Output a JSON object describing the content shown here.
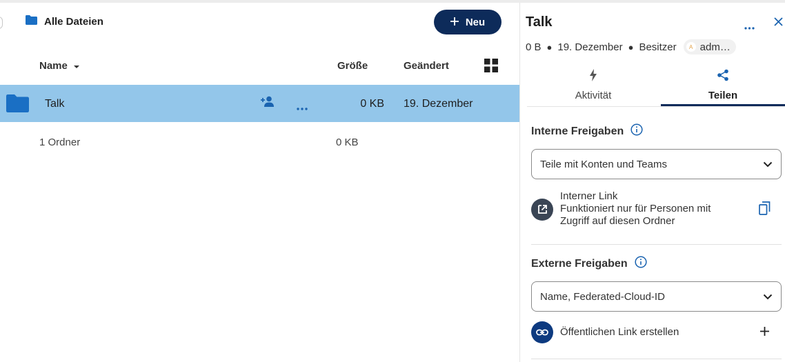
{
  "breadcrumb": {
    "label": "Alle Dateien"
  },
  "toolbar": {
    "new_label": "Neu"
  },
  "columns": {
    "name": "Name",
    "size": "Größe",
    "modified": "Geändert"
  },
  "rows": [
    {
      "name": "Talk",
      "size": "0 KB",
      "modified": "19. Dezember",
      "selected": true
    }
  ],
  "summary": {
    "count": "1 Ordner",
    "total_size": "0 KB"
  },
  "sidebar": {
    "title": "Talk",
    "size": "0 B",
    "date": "19. Dezember",
    "owner_label": "Besitzer",
    "owner_initial": "A",
    "owner_name": "adm…",
    "tabs": [
      {
        "label": "Aktivität",
        "icon": "lightning-icon",
        "active": false
      },
      {
        "label": "Teilen",
        "icon": "share-icon",
        "active": true
      }
    ],
    "internal": {
      "title": "Interne Freigaben",
      "placeholder": "Teile mit Konten und Teams",
      "link_title": "Interner Link",
      "link_desc_1": "Funktioniert nur für Personen mit",
      "link_desc_2": "Zugriff auf diesen Ordner"
    },
    "external": {
      "title": "Externe Freigaben",
      "placeholder": "Name, Federated-Cloud-ID",
      "public_link": "Öffentlichen Link erstellen"
    }
  },
  "colors": {
    "primary": "#0d2b5a",
    "selected_row": "#93c6ea",
    "folder": "#1a6fc4",
    "accent_icon": "#1a63b0"
  }
}
